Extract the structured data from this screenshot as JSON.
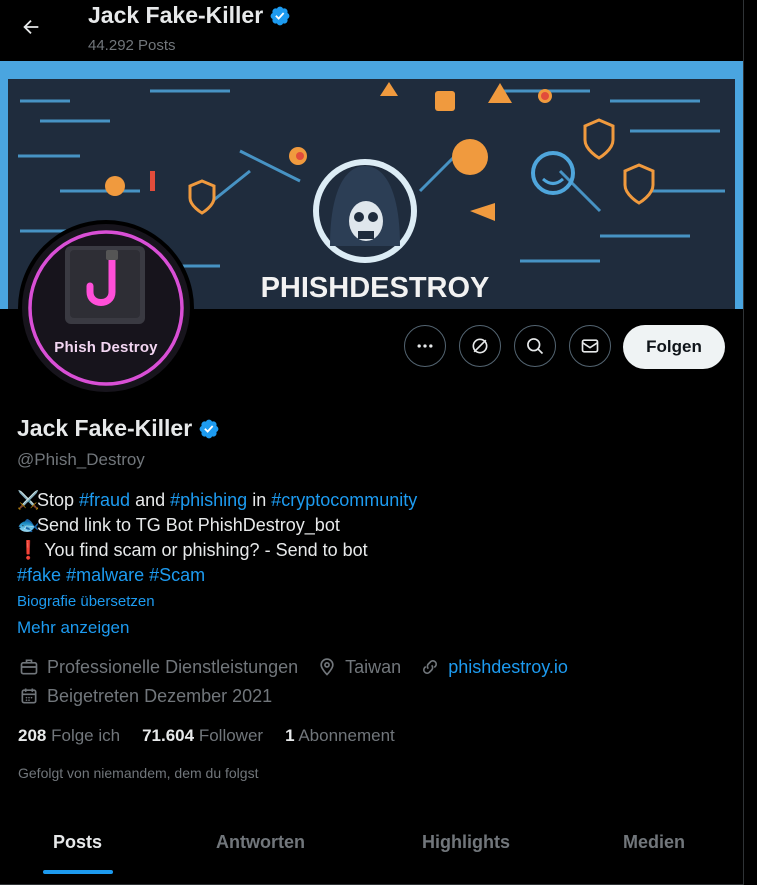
{
  "header": {
    "title": "Jack Fake-Killer",
    "post_count": "44.292 Posts"
  },
  "banner": {
    "wordmark": "PHISHDESTROY"
  },
  "avatar": {
    "caption": "Phish Destroy"
  },
  "actions": {
    "follow_label": "Folgen",
    "icons": [
      "more-icon",
      "subscribe-icon",
      "search-icon",
      "message-icon"
    ]
  },
  "profile": {
    "name": "Jack Fake-Killer",
    "handle": "@Phish_Destroy",
    "bio": {
      "line1": {
        "emoji": "⚔️",
        "stop": "Stop ",
        "fraud": "#fraud",
        "and": " and ",
        "phishing": "#phishing",
        "in": " in ",
        "crypto": "#cryptocommunity"
      },
      "line2": {
        "emoji": "🐟",
        "text": "Send link to TG Bot PhishDestroy_bot"
      },
      "line3": {
        "emoji": "❗",
        "text": " You find scam or phishing? - Send to bot"
      },
      "line4": {
        "fake": "#fake",
        "malware": "#malware",
        "scam": "#Scam"
      }
    },
    "translate_label": "Biografie übersetzen",
    "show_more_label": "Mehr anzeigen",
    "category": "Professionelle Dienstleistungen",
    "location": "Taiwan",
    "website": "phishdestroy.io",
    "joined": "Beigetreten Dezember 2021",
    "following_count": "208",
    "following_label": "Folge ich",
    "followers_count": "71.604",
    "followers_label": "Follower",
    "subs_count": "1",
    "subs_label": "Abonnement",
    "followed_by": "Gefolgt von niemandem, dem du folgst"
  },
  "tabs": [
    {
      "label": "Posts",
      "active": true
    },
    {
      "label": "Antworten",
      "active": false
    },
    {
      "label": "Highlights",
      "active": false
    },
    {
      "label": "Medien",
      "active": false
    }
  ],
  "colors": {
    "accent": "#1d9bf0",
    "muted": "#71767b",
    "text": "#e7e9ea",
    "avatar_ring": "#d94fd6"
  }
}
